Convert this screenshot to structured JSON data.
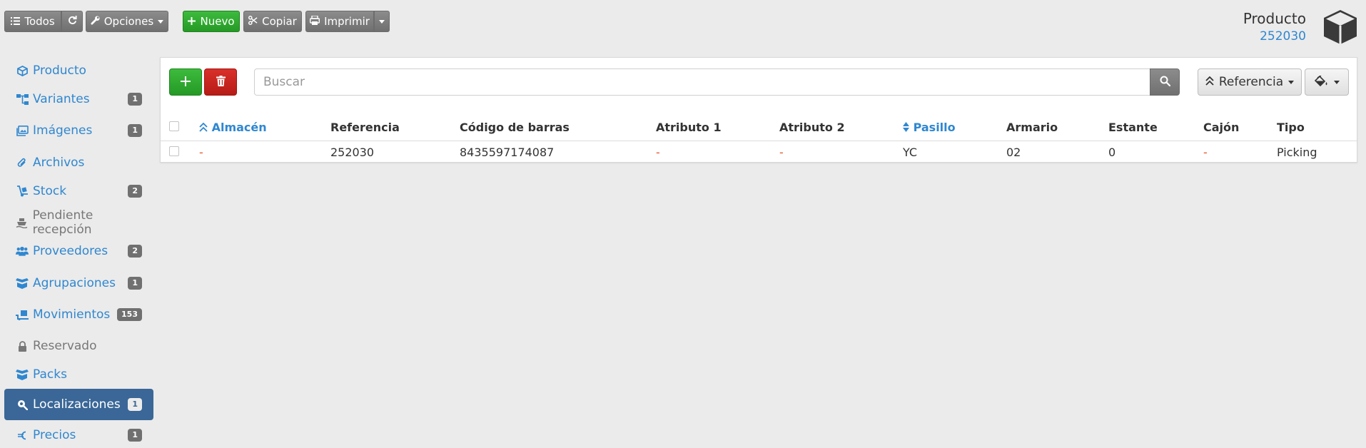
{
  "toolbar": {
    "todos_label": "Todos",
    "opciones_label": "Opciones",
    "nuevo_label": "Nuevo",
    "copiar_label": "Copiar",
    "imprimir_label": "Imprimir"
  },
  "product": {
    "title": "Producto",
    "code": "252030"
  },
  "sidebar": {
    "items": [
      {
        "label": "Producto",
        "icon": "cube-icon",
        "badge": ""
      },
      {
        "label": "Variantes",
        "icon": "sitemap-icon",
        "badge": "1"
      },
      {
        "label": "Imágenes",
        "icon": "images-icon",
        "badge": "1"
      },
      {
        "label": "Archivos",
        "icon": "paperclip-icon",
        "badge": ""
      },
      {
        "label": "Stock",
        "icon": "dolly-icon",
        "badge": "2"
      },
      {
        "label": "Pendiente recepción",
        "icon": "ship-icon",
        "badge": ""
      },
      {
        "label": "Proveedores",
        "icon": "users-icon",
        "badge": "2"
      },
      {
        "label": "Agrupaciones",
        "icon": "box-open-icon",
        "badge": "1"
      },
      {
        "label": "Movimientos",
        "icon": "truck-loading-icon",
        "badge": "153"
      },
      {
        "label": "Reservado",
        "icon": "lock-icon",
        "badge": ""
      },
      {
        "label": "Packs",
        "icon": "box-open-icon",
        "badge": ""
      },
      {
        "label": "Localizaciones",
        "icon": "search-location-icon",
        "badge": "1"
      },
      {
        "label": "Precios",
        "icon": "euro-icon",
        "badge": "1"
      }
    ]
  },
  "panel": {
    "search_placeholder": "Buscar",
    "sort_button_label": "Referencia"
  },
  "table": {
    "columns": [
      "Almacén",
      "Referencia",
      "Código de barras",
      "Atributo 1",
      "Atributo 2",
      "Pasillo",
      "Armario",
      "Estante",
      "Cajón",
      "Tipo"
    ],
    "rows": [
      [
        "-",
        "252030",
        "8435597174087",
        "-",
        "-",
        "YC",
        "02",
        "0",
        "-",
        "Picking"
      ]
    ]
  },
  "colors": {
    "accent": "#2f87d0",
    "active_sidebar": "#3a6797",
    "success": "#2ca52c",
    "danger": "#c62520",
    "dash": "#e8562a"
  }
}
